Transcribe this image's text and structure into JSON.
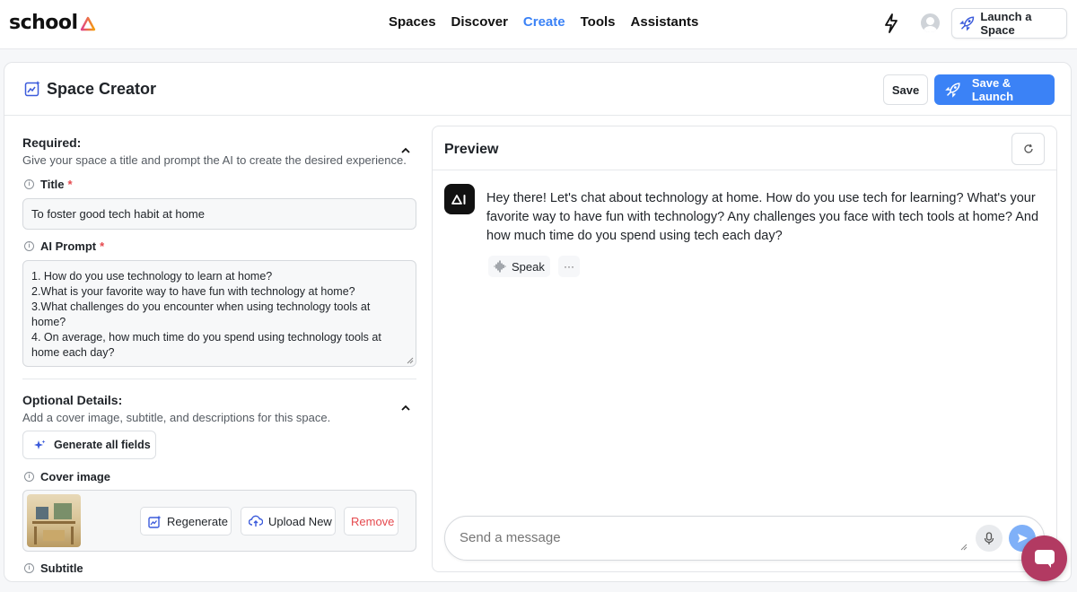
{
  "app": {
    "logo_text": "school"
  },
  "nav": {
    "items": [
      "Spaces",
      "Discover",
      "Create",
      "Tools",
      "Assistants"
    ],
    "active": "Create"
  },
  "header_actions": {
    "launch_label": "Launch a Space"
  },
  "card": {
    "title": "Space Creator",
    "save_label": "Save",
    "save_launch_label": "Save & Launch"
  },
  "required": {
    "title": "Required:",
    "description": "Give your space a title and prompt the AI to create the desired experience.",
    "title_field_label": "Title",
    "title_value": "To foster good tech habit at home",
    "prompt_field_label": "AI Prompt",
    "required_mark": "*",
    "prompt_lines": [
      "1. How do you use technology to learn at home?",
      "2.What is your favorite way to have fun with technology at home?",
      "3.What challenges do you encounter when using technology tools at home?",
      "4. On average, how much time do you spend using technology tools at home each day?"
    ]
  },
  "optional": {
    "title": "Optional Details:",
    "description": "Add a cover image, subtitle, and descriptions for this space.",
    "generate_label": "Generate all fields",
    "cover_label": "Cover image",
    "regenerate_label": "Regenerate",
    "upload_label": "Upload New",
    "remove_label": "Remove",
    "subtitle_label": "Subtitle"
  },
  "preview": {
    "title": "Preview",
    "bot_message": "Hey there! Let's chat about technology at home. How do you use tech for learning? What's your favorite way to have fun with technology? Any challenges you face with tech tools at home? And how much time do you spend using tech each day?",
    "speak_label": "Speak",
    "more_label": "···",
    "input_placeholder": "Send a message"
  },
  "colors": {
    "accent": "#3b82f6",
    "danger": "#e5484d",
    "chat_widget": "#b23a62"
  },
  "icons": [
    "bolt-icon",
    "rocket-icon",
    "creator-icon",
    "chevron-up-icon",
    "info-icon",
    "sparkle-icon",
    "image-edit-icon",
    "cloud-upload-icon",
    "refresh-icon",
    "sound-wave-icon",
    "mic-icon",
    "send-icon",
    "chat-icon"
  ]
}
